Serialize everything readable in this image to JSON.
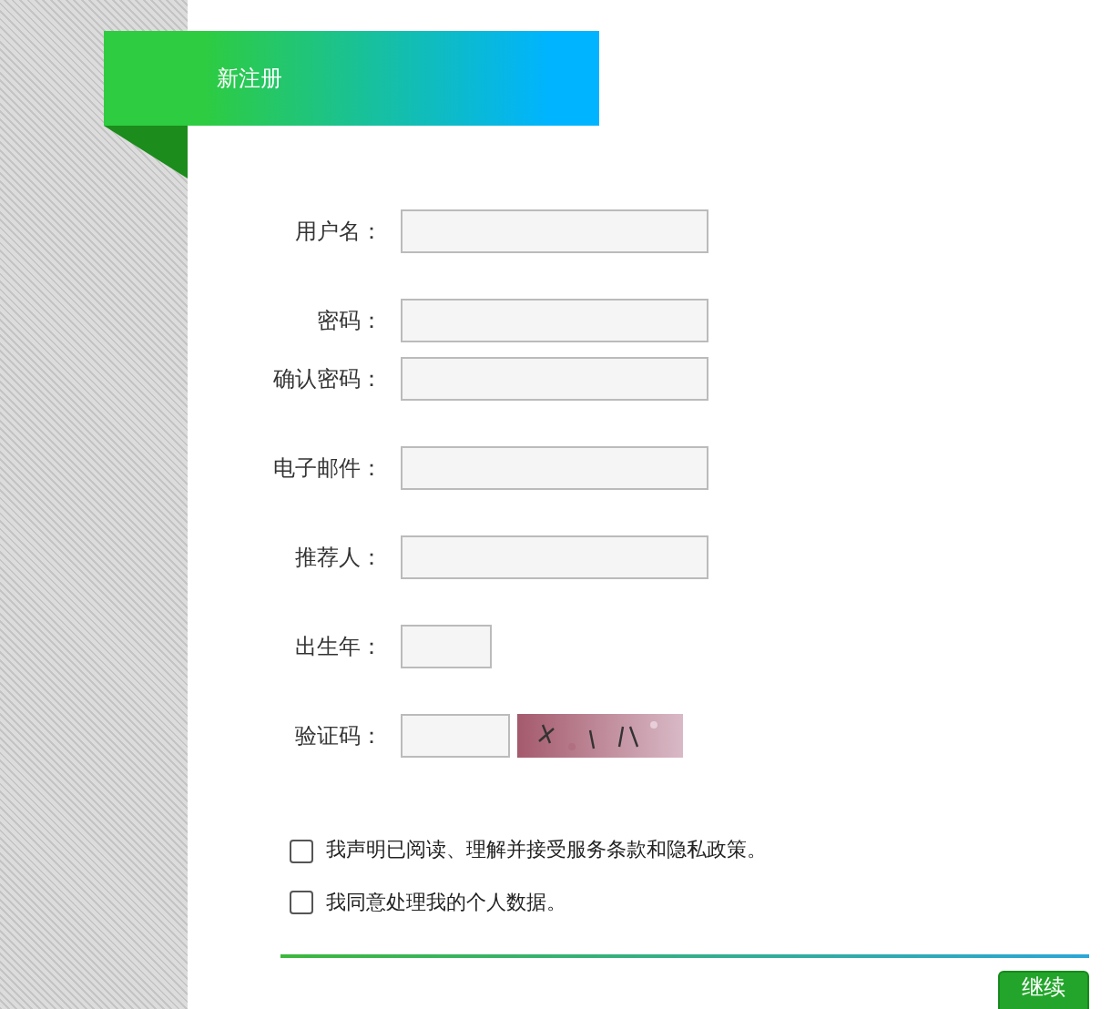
{
  "header": {
    "title": "新注册"
  },
  "fields": [
    {
      "label": "用户名：",
      "kind": "text"
    },
    {
      "label": "密码：",
      "kind": "text"
    },
    {
      "label": "确认密码：",
      "kind": "text"
    },
    {
      "label": "电子邮件：",
      "kind": "text"
    },
    {
      "label": "推荐人：",
      "kind": "text"
    },
    {
      "label": "出生年：",
      "kind": "short"
    },
    {
      "label": "验证码：",
      "kind": "captcha"
    }
  ],
  "agreements": [
    {
      "label": "我声明已阅读、理解并接受服务条款和隐私政策。",
      "checked": false
    },
    {
      "label": "我同意处理我的个人数据。",
      "checked": false
    }
  ],
  "submit": {
    "label": "继续"
  }
}
